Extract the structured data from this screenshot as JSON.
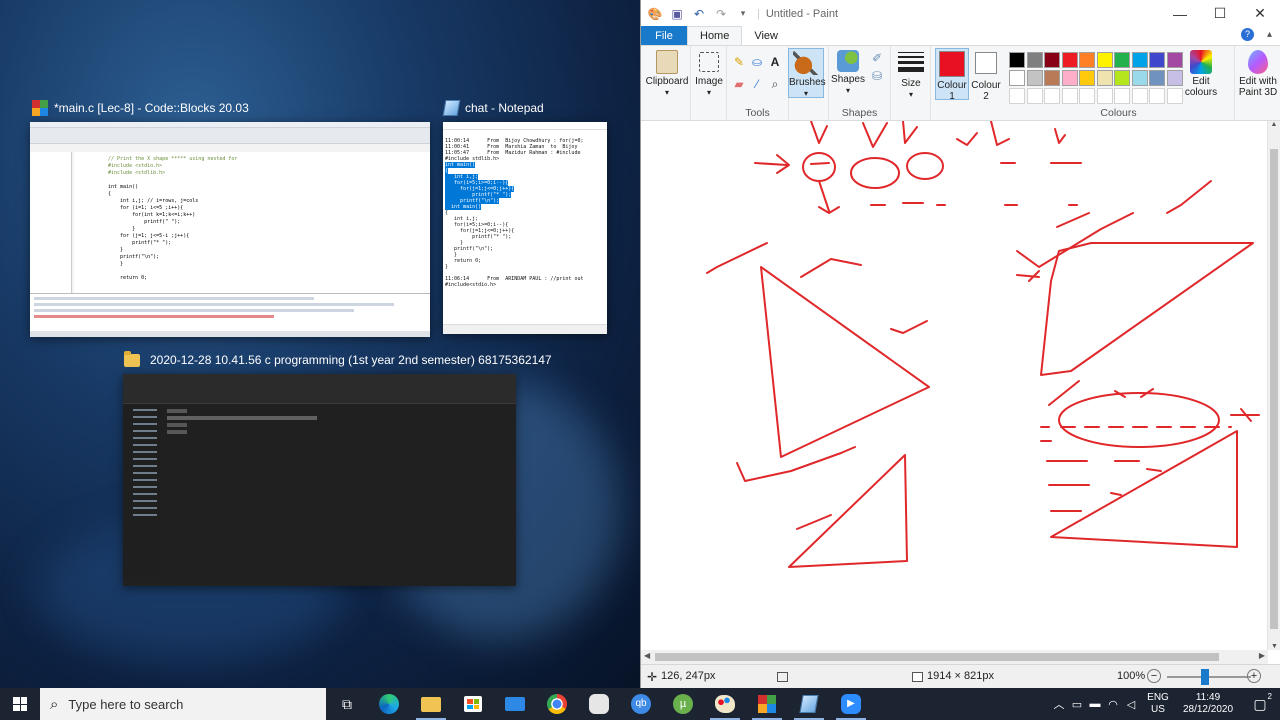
{
  "taskview": {
    "codeblocks": {
      "title": "*main.c [Lec-8] - Code::Blocks 20.03",
      "code_lines": [
        "// Print the X shape ***** using nested for",
        "#include <stdio.h>",
        "#include <stdlib.h>",
        "",
        "int main()",
        "{",
        "    int i,j; // i=rows, j=cols",
        "    for (i=1; i<=5 ;i++){",
        "        for(int k=1;k<=i;k++)",
        "            printf(\" \");",
        "        }",
        "    for (j=1; j<=5-i ;j++){",
        "        printf(\"* \");",
        "    }",
        "    printf(\"\\n\");",
        "    }",
        "",
        "    return 0;"
      ]
    },
    "notepad": {
      "title": "chat - Notepad",
      "chat_lines": [
        "11:00:14      From  Bijoy Chowdhury : for(j=0;",
        "11:00:41      From  Marshia Zaman  to  Bijoy",
        "11:05:47      From  Mazidur Rahman : #include",
        "#include stdlib.h>"
      ],
      "selected_lines": [
        "int main()",
        "{",
        "   int i,j;",
        "   for(i=5;i>=0;i--){",
        "     for(j=1;j<=0;j++){",
        "         printf(\"* \");",
        "     printf(\"\\n\");",
        "  int main()"
      ],
      "more_lines": [
        "{",
        "   int i,j;",
        "   for(i=5;i>=0;i--){",
        "     for(j=1;j<=0;j++){",
        "         printf(\"* \");",
        "     }",
        "   printf(\"\\n\");",
        "   }",
        "   return 0;",
        "}",
        "",
        "11:06:14      From  ARINDAM PAUL : //print out",
        "#include<stdio.h>"
      ]
    },
    "explorer": {
      "title": "2020-12-28 10.41.56 c programming (1st year 2nd semester) 68175362147"
    }
  },
  "paint": {
    "title": "Untitled - Paint",
    "tabs": {
      "file": "File",
      "home": "Home",
      "view": "View"
    },
    "groups": {
      "clipboard": "Clipboard",
      "image": "Image",
      "tools": "Tools",
      "brushes": "Brushes",
      "shapes": "Shapes",
      "shapes_group": "Shapes",
      "size": "Size",
      "colour1": "Colour",
      "colour1_num": "1",
      "colour2": "Colour",
      "colour2_num": "2",
      "colours": "Colours",
      "edit_colours_1": "Edit",
      "edit_colours_2": "colours",
      "paint3d_1": "Edit with",
      "paint3d_2": "Paint 3D"
    },
    "colors": {
      "active": "#e81123",
      "palette_row1": [
        "#000000",
        "#7f7f7f",
        "#880015",
        "#ed1c24",
        "#ff7f27",
        "#fff200",
        "#22b14c",
        "#00a2e8",
        "#3f48cc",
        "#a349a4"
      ],
      "palette_row2": [
        "#ffffff",
        "#c3c3c3",
        "#b97a57",
        "#ffaec9",
        "#ffc90e",
        "#efe4b0",
        "#b5e61d",
        "#99d9ea",
        "#7092be",
        "#c8bfe7"
      ],
      "stroke": "#e0282b"
    },
    "status": {
      "cursor_pos": "126, 247px",
      "canvas_size": "1914 × 821px",
      "zoom": "100%"
    }
  },
  "taskbar": {
    "search_placeholder": "Type here to search",
    "lang1": "ENG",
    "lang2": "US",
    "time": "11:49",
    "date": "28/12/2020",
    "notif_count": "2"
  }
}
